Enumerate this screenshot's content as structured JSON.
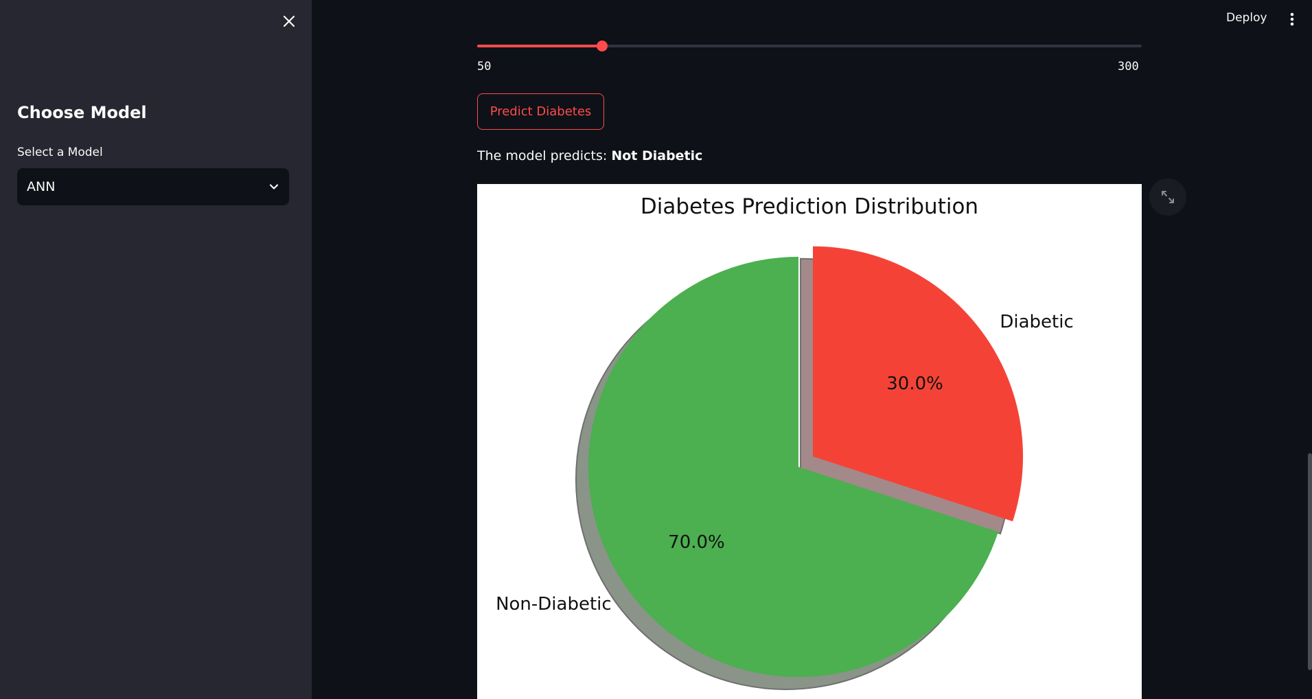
{
  "sidebar": {
    "title": "Choose Model",
    "select_label": "Select a Model",
    "select_value": "ANN"
  },
  "header": {
    "deploy_label": "Deploy"
  },
  "slider": {
    "min_label": "50",
    "max_label": "300",
    "min": 50,
    "max": 300,
    "value": 97
  },
  "predict_button_label": "Predict Diabetes",
  "result": {
    "prefix": "The model predicts: ",
    "value": "Not Diabetic"
  },
  "colors": {
    "accent": "#ff4b4b",
    "non_diabetic": "#4caf50",
    "diabetic": "#f44336"
  },
  "chart_data": {
    "type": "pie",
    "title": "Diabetes Prediction Distribution",
    "slices": [
      {
        "label": "Non-Diabetic",
        "value": 70.0,
        "pct_label": "70.0%",
        "color": "#4caf50",
        "exploded": false
      },
      {
        "label": "Diabetic",
        "value": 30.0,
        "pct_label": "30.0%",
        "color": "#f44336",
        "exploded": true
      }
    ],
    "start_angle_deg": 90,
    "shadow": true,
    "legend": "none"
  }
}
